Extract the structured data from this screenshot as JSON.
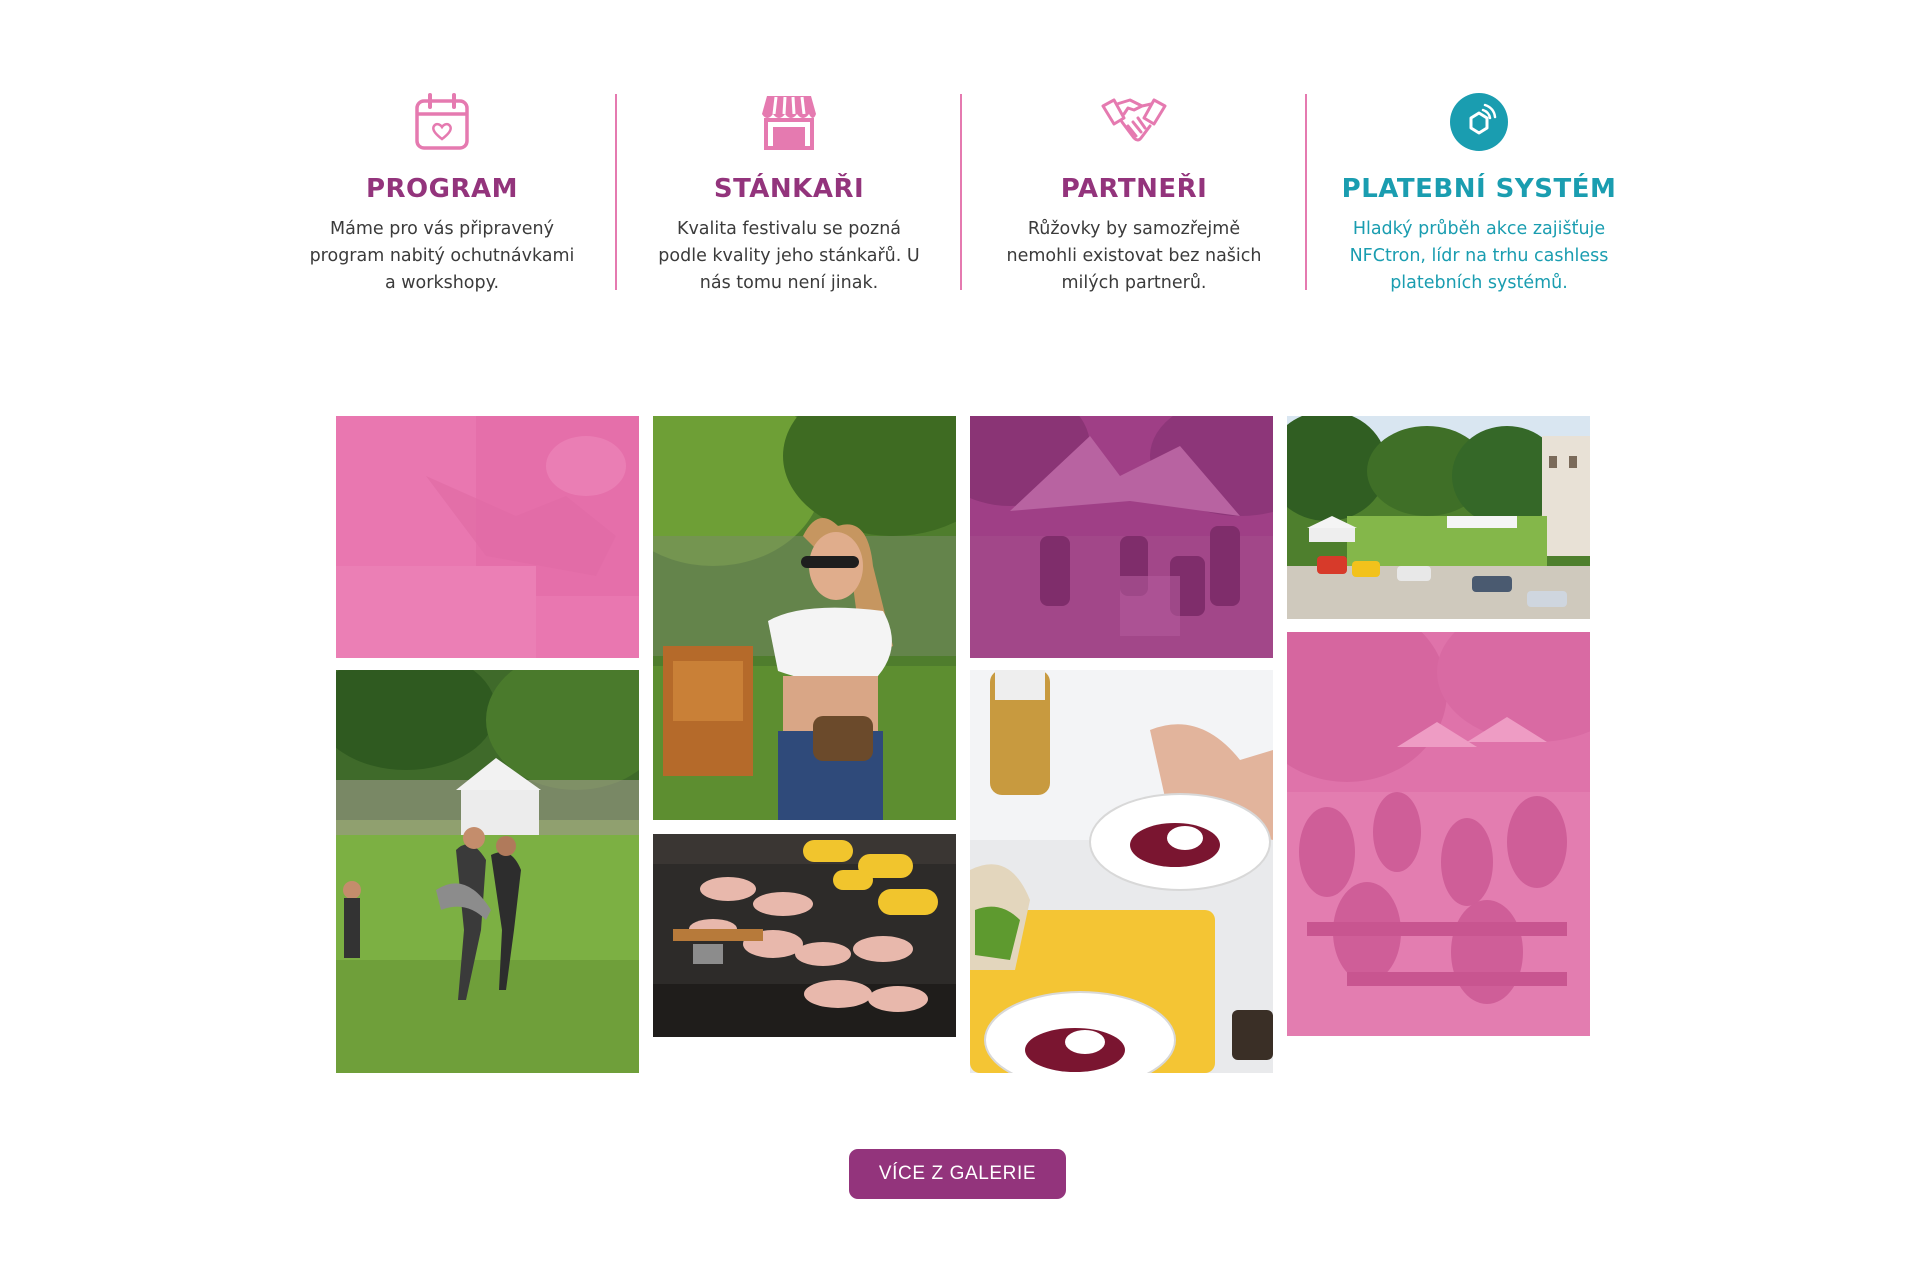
{
  "features": [
    {
      "icon": "calendar-heart-icon",
      "title": "PROGRAM",
      "text": "Máme pro vás připravený program nabitý ochutnávkami a workshopy."
    },
    {
      "icon": "market-stall-icon",
      "title": "STÁNKAŘI",
      "text": "Kvalita festivalu se pozná podle kvality jeho stánkařů. U nás tomu není jinak."
    },
    {
      "icon": "handshake-icon",
      "title": "PARTNEŘI",
      "text": "Růžovky by samozřejmě nemohli existovat bez našich milých partnerů."
    },
    {
      "icon": "nfc-payment-icon",
      "title": "PLATEBNÍ SYSTÉM",
      "text": "Hladký průběh akce zajišťuje NFCtron, lídr na trhu cashless platebních systémů."
    }
  ],
  "gallery": {
    "more_label": "VÍCE Z GALERIE"
  },
  "colors": {
    "primary": "#93347c",
    "pink": "#e57ab0",
    "accent": "#1a9db0",
    "text": "#3b3b3b"
  }
}
